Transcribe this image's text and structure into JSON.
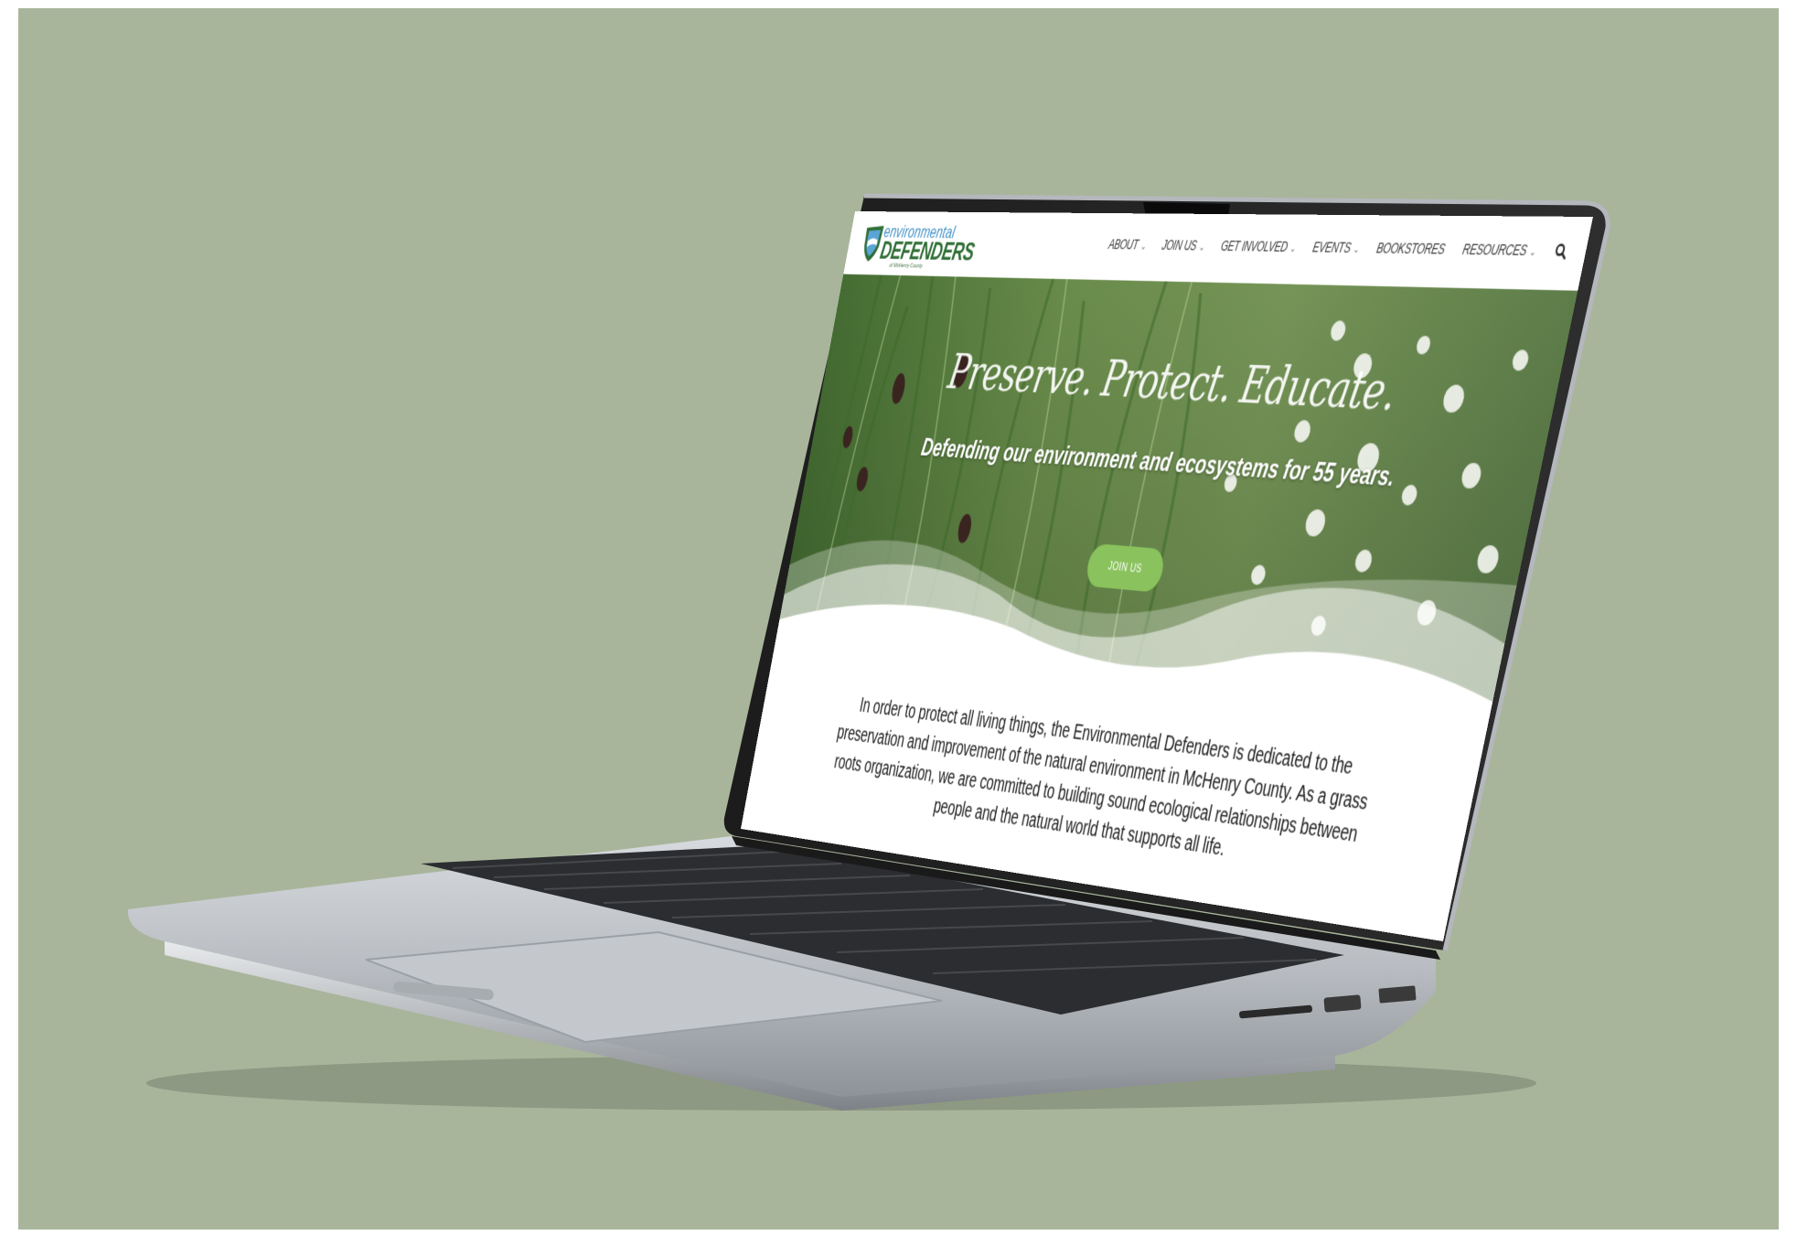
{
  "site": {
    "logo": {
      "line1": "environmental",
      "line2": "DEFENDERS",
      "line3": "of McHenry County"
    },
    "nav": {
      "items": [
        {
          "label": "ABOUT",
          "dropdown": true
        },
        {
          "label": "JOIN US",
          "dropdown": true
        },
        {
          "label": "GET INVOLVED",
          "dropdown": true
        },
        {
          "label": "EVENTS",
          "dropdown": true
        },
        {
          "label": "BOOKSTORES",
          "dropdown": false
        },
        {
          "label": "RESOURCES",
          "dropdown": true
        }
      ],
      "search_icon": "search-icon"
    },
    "hero": {
      "title": "Preserve. Protect. Educate.",
      "subtitle": "Defending our environment and ecosystems for 55 years.",
      "button": "JOIN US"
    },
    "mission": "In order to protect all living things, the Environmental Defenders is dedicated to the preservation and improvement of the natural environment in McHenry County. As a grass roots organization, we are committed to building sound ecological relationships between people and the natural world that supports all life."
  },
  "colors": {
    "backdrop": "#a8b59b",
    "accent_green": "#8ac25d",
    "logo_blue": "#3f8fc8",
    "logo_green": "#2f6e34"
  }
}
